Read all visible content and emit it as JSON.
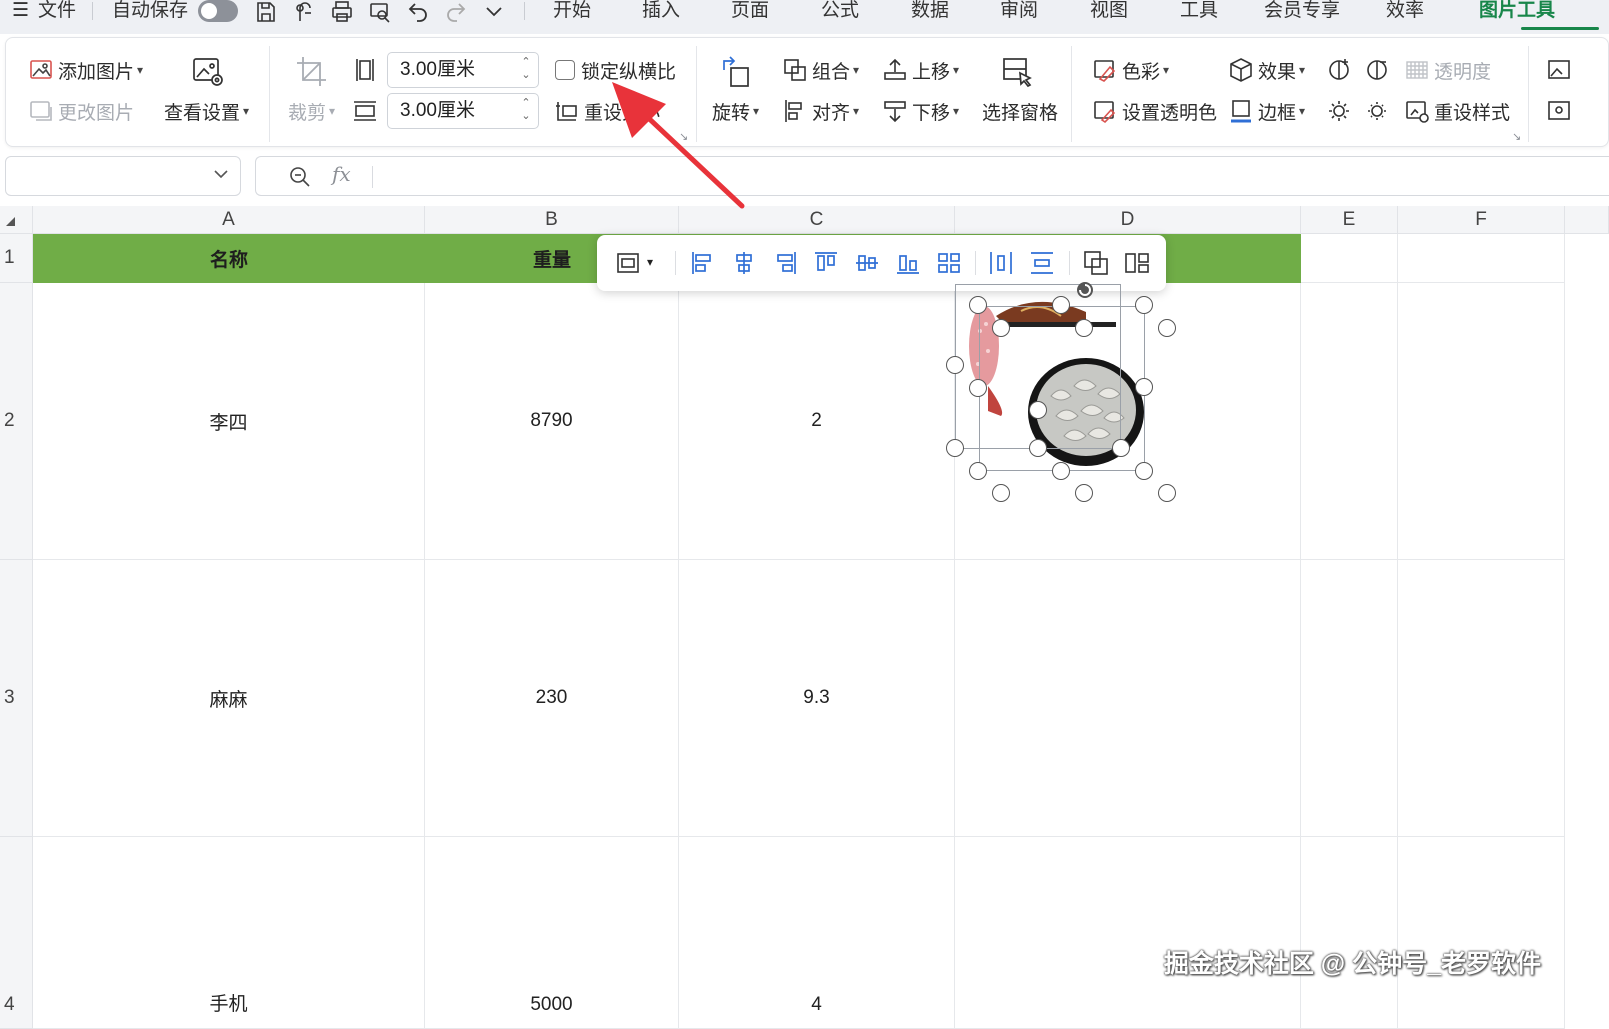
{
  "menubar": {
    "hamburger": "☰",
    "file": "文件",
    "autosave": "自动保存",
    "tabs": [
      "开始",
      "插入",
      "页面",
      "公式",
      "数据",
      "审阅",
      "视图",
      "工具",
      "会员专享",
      "效率",
      "图片工具"
    ],
    "active_tab": "图片工具"
  },
  "ribbon": {
    "add_picture": "添加图片",
    "change_picture": "更改图片",
    "view_settings": "查看设置",
    "crop": "裁剪",
    "height_value": "3.00厘米",
    "width_value": "3.00厘米",
    "lock_aspect": "锁定纵横比",
    "reset_size": "重设大小",
    "rotate": "旋转",
    "group": "组合",
    "align": "对齐",
    "bring_forward": "上移",
    "send_backward": "下移",
    "selection_pane": "选择窗格",
    "color": "色彩",
    "set_transparent_color": "设置透明色",
    "effects": "效果",
    "border": "边框",
    "transparency": "透明度",
    "reset_style": "重设样式"
  },
  "formula_bar": {
    "name_box": "",
    "fx": "fx",
    "content": ""
  },
  "sheet": {
    "columns": [
      "A",
      "B",
      "C",
      "D",
      "E",
      "F"
    ],
    "rows": [
      "1",
      "2",
      "3",
      "4"
    ],
    "header_row": [
      "名称",
      "重量",
      "",
      ""
    ],
    "data_rows": [
      [
        "李四",
        "8790",
        "2"
      ],
      [
        "麻麻",
        "230",
        "9.3"
      ],
      [
        "手机",
        "5000",
        "4"
      ]
    ],
    "header_fill": "#70ad47"
  },
  "annotation": {
    "arrow_color": "#e8333a"
  },
  "watermark": "掘金技术社区 @ 公钟号_老罗软件"
}
